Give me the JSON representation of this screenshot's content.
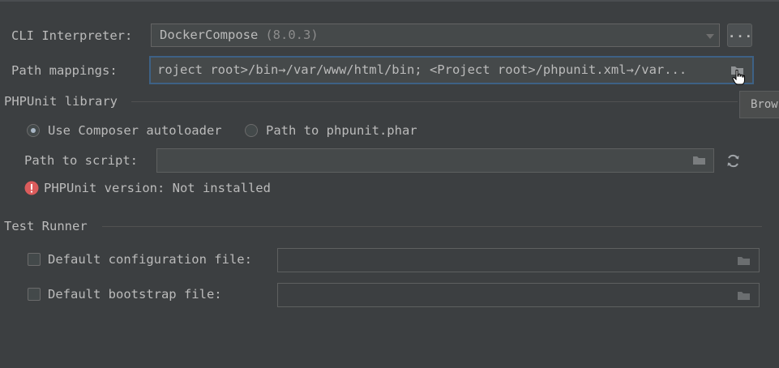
{
  "interpreter": {
    "label": "CLI Interpreter:",
    "value": "DockerCompose",
    "version": "(8.0.3)",
    "more_button": "..."
  },
  "path_mappings": {
    "label": "Path mappings:",
    "value": "roject root>/bin→/var/www/html/bin; <Project root>/phpunit.xml→/var..."
  },
  "phpunit": {
    "section_title": "PHPUnit library",
    "radio_composer": "Use Composer autoloader",
    "radio_composer_selected": true,
    "radio_phar": "Path to phpunit.phar",
    "script_label": "Path to script:",
    "script_value": "",
    "version_status": "PHPUnit version: Not installed"
  },
  "test_runner": {
    "section_title": "Test Runner",
    "config_label": "Default configuration file:",
    "config_checked": false,
    "config_value": "",
    "bootstrap_label": "Default bootstrap file:",
    "bootstrap_checked": false,
    "bootstrap_value": ""
  },
  "tooltip": {
    "text": "Brow"
  },
  "colors": {
    "background": "#3c3f41",
    "text": "#bbbbbb",
    "focus_border": "#3d6185",
    "error_icon": "#db5c5c"
  },
  "icons": [
    "chevron-down-icon",
    "folder-icon",
    "refresh-icon",
    "error-icon",
    "hand-cursor-icon"
  ]
}
